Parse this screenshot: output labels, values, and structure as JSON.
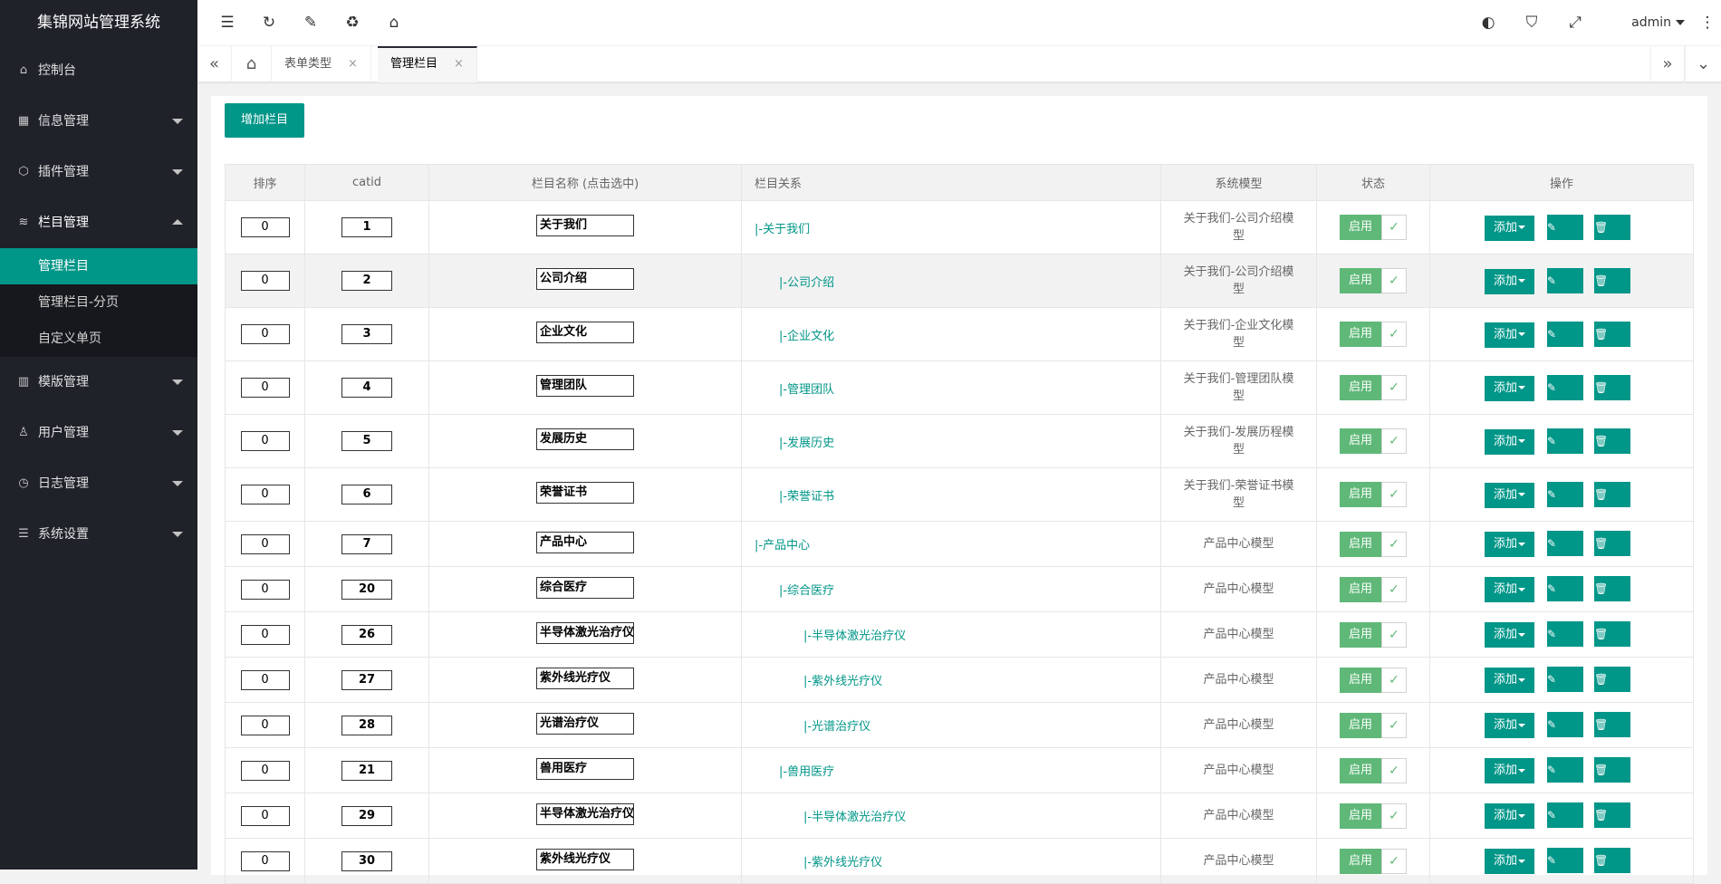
{
  "app_title": "集锦网站管理系统",
  "sidebar": {
    "items": [
      {
        "label": "控制台",
        "icon": "home-icon"
      },
      {
        "label": "信息管理",
        "icon": "apps-icon"
      },
      {
        "label": "插件管理",
        "icon": "cube-icon"
      },
      {
        "label": "栏目管理",
        "icon": "layers-icon",
        "open": true
      },
      {
        "label": "模版管理",
        "icon": "template-icon"
      },
      {
        "label": "用户管理",
        "icon": "user-icon"
      },
      {
        "label": "日志管理",
        "icon": "clock-icon"
      },
      {
        "label": "系统设置",
        "icon": "settings-icon"
      }
    ],
    "sub_items": [
      "管理栏目",
      "管理栏目-分页",
      "自定义单页"
    ]
  },
  "header": {
    "user": "admin"
  },
  "tabs": [
    {
      "label": "表单类型"
    },
    {
      "label": "管理栏目",
      "active": true
    }
  ],
  "toolbar": {
    "add_button": "增加栏目"
  },
  "table": {
    "headers": [
      "排序",
      "catid",
      "栏目名称 (点击选中)",
      "栏目关系",
      "系统模型",
      "状态",
      "操作"
    ],
    "status_label": "启用",
    "add_label": "添加",
    "rows": [
      {
        "sort": "0",
        "catid": "1",
        "name": "关于我们",
        "relation": "|-关于我们",
        "level": 0,
        "model": "关于我们-公司介绍模型"
      },
      {
        "sort": "0",
        "catid": "2",
        "name": "公司介绍",
        "relation": "|-公司介绍",
        "level": 1,
        "model": "关于我们-公司介绍模型"
      },
      {
        "sort": "0",
        "catid": "3",
        "name": "企业文化",
        "relation": "|-企业文化",
        "level": 1,
        "model": "关于我们-企业文化模型"
      },
      {
        "sort": "0",
        "catid": "4",
        "name": "管理团队",
        "relation": "|-管理团队",
        "level": 1,
        "model": "关于我们-管理团队模型"
      },
      {
        "sort": "0",
        "catid": "5",
        "name": "发展历史",
        "relation": "|-发展历史",
        "level": 1,
        "model": "关于我们-发展历程模型"
      },
      {
        "sort": "0",
        "catid": "6",
        "name": "荣誉证书",
        "relation": "|-荣誉证书",
        "level": 1,
        "model": "关于我们-荣誉证书模型"
      },
      {
        "sort": "0",
        "catid": "7",
        "name": "产品中心",
        "relation": "|-产品中心",
        "level": 0,
        "model": "产品中心模型"
      },
      {
        "sort": "0",
        "catid": "20",
        "name": "综合医疗",
        "relation": "|-综合医疗",
        "level": 1,
        "model": "产品中心模型"
      },
      {
        "sort": "0",
        "catid": "26",
        "name": "半导体激光治疗仪",
        "relation": "|-半导体激光治疗仪",
        "level": 2,
        "model": "产品中心模型"
      },
      {
        "sort": "0",
        "catid": "27",
        "name": "紫外线光疗仪",
        "relation": "|-紫外线光疗仪",
        "level": 2,
        "model": "产品中心模型"
      },
      {
        "sort": "0",
        "catid": "28",
        "name": "光谱治疗仪",
        "relation": "|-光谱治疗仪",
        "level": 2,
        "model": "产品中心模型"
      },
      {
        "sort": "0",
        "catid": "21",
        "name": "兽用医疗",
        "relation": "|-兽用医疗",
        "level": 1,
        "model": "产品中心模型"
      },
      {
        "sort": "0",
        "catid": "29",
        "name": "半导体激光治疗仪",
        "relation": "|-半导体激光治疗仪",
        "level": 2,
        "model": "产品中心模型"
      },
      {
        "sort": "0",
        "catid": "30",
        "name": "紫外线光疗仪",
        "relation": "|-紫外线光疗仪",
        "level": 2,
        "model": "产品中心模型"
      }
    ]
  }
}
